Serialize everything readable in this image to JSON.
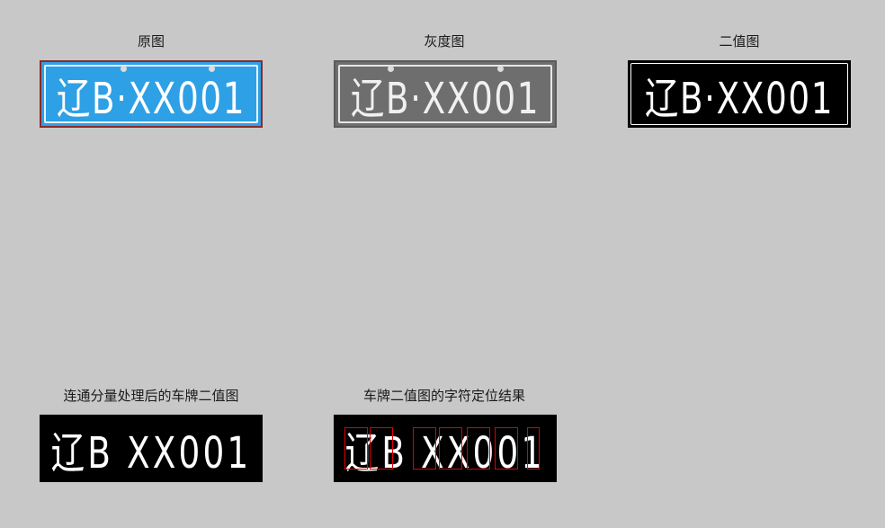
{
  "panels": [
    {
      "title": "原图",
      "plate_text": "辽B·XX001"
    },
    {
      "title": "灰度图",
      "plate_text": "辽B·XX001"
    },
    {
      "title": "二值图",
      "plate_text": "辽B·XX001"
    },
    {
      "title": "连通分量处理后的车牌二值图",
      "plate_text": "辽B XX001"
    },
    {
      "title": "车牌二值图的字符定位结果",
      "plate_text": "辽B XX001"
    }
  ],
  "colors": {
    "background": "#c8c8c8",
    "plate_blue": "#2ea0e6",
    "bbox_red": "#e00000"
  }
}
